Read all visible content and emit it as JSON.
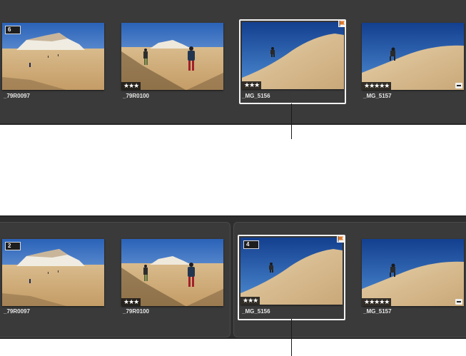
{
  "top_strip": {
    "photos": [
      {
        "name": "_79R0097",
        "stack_count": "6",
        "rating": "",
        "edited": false,
        "flagged": false
      },
      {
        "name": "_79R0100",
        "stack_count": "",
        "rating": "★★★",
        "edited": false,
        "flagged": false
      },
      {
        "name": "_MG_5156",
        "stack_count": "",
        "rating": "★★★",
        "edited": false,
        "flagged": true,
        "selected": true
      },
      {
        "name": "_MG_5157",
        "stack_count": "",
        "rating": "★★★★★",
        "edited": true,
        "flagged": false
      }
    ]
  },
  "bottom_strip": {
    "photos": [
      {
        "name": "_79R0097",
        "stack_count": "2",
        "rating": "",
        "edited": false,
        "flagged": false
      },
      {
        "name": "_79R0100",
        "stack_count": "",
        "rating": "★★★",
        "edited": false,
        "flagged": false
      },
      {
        "name": "_MG_5156",
        "stack_count": "4",
        "rating": "★★★",
        "edited": false,
        "flagged": true,
        "selected": true
      },
      {
        "name": "_MG_5157",
        "stack_count": "",
        "rating": "★★★★★",
        "edited": true,
        "flagged": false
      }
    ]
  },
  "colors": {
    "strip_bg": "#3a3a3a",
    "selection": "#f2f2f2",
    "flag": "#e07a2a"
  }
}
